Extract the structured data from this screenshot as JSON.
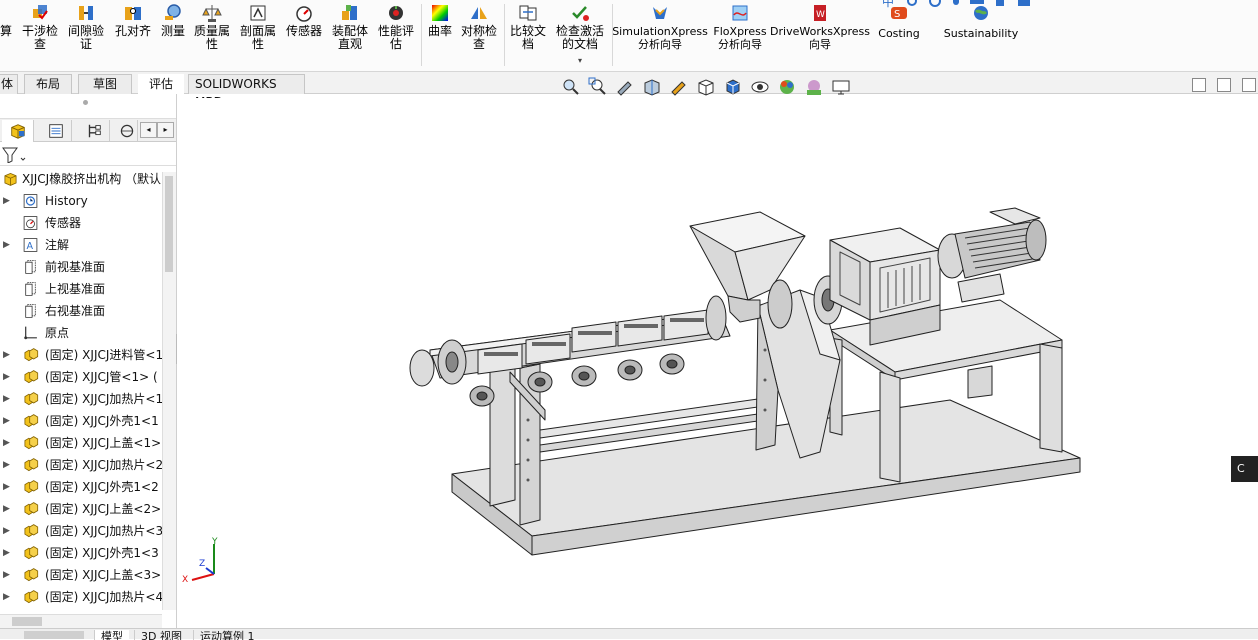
{
  "ribbon": {
    "buttons": [
      {
        "label1": "算",
        "label2": "",
        "name": "calc-button"
      },
      {
        "label1": "干涉检",
        "label2": "查",
        "name": "interference-check-button"
      },
      {
        "label1": "间隙验",
        "label2": "证",
        "name": "clearance-verify-button"
      },
      {
        "label1": "孔对齐",
        "label2": "",
        "name": "hole-align-button"
      },
      {
        "label1": "测量",
        "label2": "",
        "name": "measure-button"
      },
      {
        "label1": "质量属",
        "label2": "性",
        "name": "mass-properties-button"
      },
      {
        "label1": "剖面属",
        "label2": "性",
        "name": "section-properties-button"
      },
      {
        "label1": "传感器",
        "label2": "",
        "name": "sensor-button"
      },
      {
        "label1": "装配体",
        "label2": "直观",
        "name": "assembly-visualization-button"
      },
      {
        "label1": "性能评",
        "label2": "估",
        "name": "performance-evaluation-button"
      },
      {
        "label1": "曲率",
        "label2": "",
        "name": "curvature-button"
      },
      {
        "label1": "对称检",
        "label2": "查",
        "name": "symmetry-check-button"
      },
      {
        "label1": "比较文",
        "label2": "档",
        "name": "compare-documents-button"
      },
      {
        "label1": "检查激活",
        "label2": "的文档",
        "name": "check-active-document-button"
      },
      {
        "label1": "SimulationXpress",
        "label2": "分析向导",
        "name": "simulationxpress-button"
      },
      {
        "label1": "FloXpress",
        "label2": "分析向导",
        "name": "floxpress-button"
      },
      {
        "label1": "DriveWorksXpress",
        "label2": "向导",
        "name": "driveworksxpress-button"
      },
      {
        "label1": "Costing",
        "label2": "",
        "name": "costing-button"
      },
      {
        "label1": "Sustainability",
        "label2": "",
        "name": "sustainability-button"
      }
    ],
    "dropdown_glyph": "▾"
  },
  "tabs": [
    "体",
    "布局",
    "草图",
    "评估",
    "SOLIDWORKS MBD"
  ],
  "feature_tree": {
    "root": "XJJCJ橡胶挤出机构 （默认",
    "items": [
      {
        "label": "History",
        "icon": "history-icon",
        "arrow": true
      },
      {
        "label": "传感器",
        "icon": "sensor-icon",
        "arrow": false
      },
      {
        "label": "注解",
        "icon": "annotation-icon",
        "arrow": true
      },
      {
        "label": "前视基准面",
        "icon": "plane-icon",
        "arrow": false
      },
      {
        "label": "上视基准面",
        "icon": "plane-icon",
        "arrow": false
      },
      {
        "label": "右视基准面",
        "icon": "plane-icon",
        "arrow": false
      },
      {
        "label": "原点",
        "icon": "origin-icon",
        "arrow": false
      },
      {
        "label": "(固定) XJJCJ进料管<1",
        "icon": "part-icon",
        "arrow": true
      },
      {
        "label": "(固定) XJJCJ管<1> (",
        "icon": "part-icon",
        "arrow": true
      },
      {
        "label": "(固定) XJJCJ加热片<1",
        "icon": "part-icon",
        "arrow": true
      },
      {
        "label": "(固定) XJJCJ外壳1<1",
        "icon": "part-icon",
        "arrow": true
      },
      {
        "label": "(固定) XJJCJ上盖<1>",
        "icon": "part-icon",
        "arrow": true
      },
      {
        "label": "(固定) XJJCJ加热片<2",
        "icon": "part-icon",
        "arrow": true
      },
      {
        "label": "(固定) XJJCJ外壳1<2",
        "icon": "part-icon",
        "arrow": true
      },
      {
        "label": "(固定) XJJCJ上盖<2>",
        "icon": "part-icon",
        "arrow": true
      },
      {
        "label": "(固定) XJJCJ加热片<3",
        "icon": "part-icon",
        "arrow": true
      },
      {
        "label": "(固定) XJJCJ外壳1<3",
        "icon": "part-icon",
        "arrow": true
      },
      {
        "label": "(固定) XJJCJ上盖<3>",
        "icon": "part-icon",
        "arrow": true
      },
      {
        "label": "(固定) XJJCJ加热片<4",
        "icon": "part-icon",
        "arrow": true
      }
    ]
  },
  "bottom_tabs": [
    "模型",
    "3D 视图",
    "运动算例 1"
  ],
  "triad": {
    "x": "X",
    "y": "Y",
    "z": "Z"
  },
  "colors": {
    "accent": "#2b6cc4",
    "part_yellow": "#f2c21b"
  }
}
